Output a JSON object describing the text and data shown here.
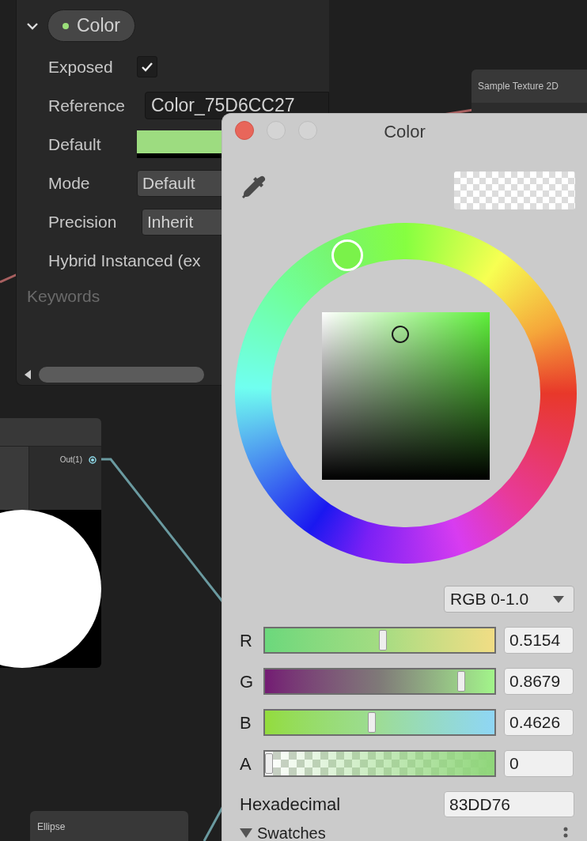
{
  "inspector": {
    "property": {
      "name": "Color",
      "color": "#9be07a",
      "expanded": true
    },
    "fields": [
      {
        "kind": "checkbox",
        "label": "Exposed",
        "checked": true
      },
      {
        "kind": "text",
        "label": "Reference",
        "value": "Color_75D6CC27"
      },
      {
        "kind": "color",
        "label": "Default",
        "color": "#9ddc80"
      },
      {
        "kind": "dropdown",
        "label": "Mode",
        "value": "Default"
      },
      {
        "kind": "dropdown",
        "label": "Precision",
        "value": "Inherit"
      },
      {
        "kind": "label",
        "label": "Hybrid Instanced (ex"
      }
    ],
    "section": "Keywords"
  },
  "graph": {
    "texture_node": {
      "title": "Sample Texture 2D"
    },
    "preview_node": {
      "port": "Out(1)"
    },
    "ellipse_node": {
      "title": "Ellipse"
    }
  },
  "color_picker": {
    "title": "Color",
    "mode": "RGB 0-1.0",
    "channels": [
      {
        "label": "R",
        "value": "0.5154",
        "level": 0.5154
      },
      {
        "label": "G",
        "value": "0.8679",
        "level": 0.8679
      },
      {
        "label": "B",
        "value": "0.4626",
        "level": 0.4626
      },
      {
        "label": "A",
        "value": "0",
        "level": 0
      }
    ],
    "hex_label": "Hexadecimal",
    "hex": "83DD76",
    "swatches_label": "Swatches"
  }
}
